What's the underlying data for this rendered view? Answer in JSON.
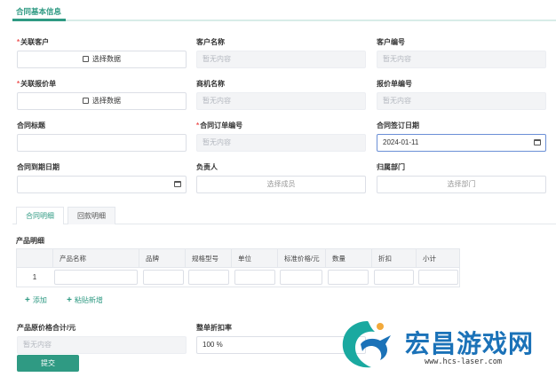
{
  "section_tab": "合同基本信息",
  "fields": {
    "customer": {
      "label": "关联客户",
      "required": true,
      "value": "选择数据"
    },
    "customer_name": {
      "label": "客户名称",
      "value": "暂无内容"
    },
    "customer_no": {
      "label": "客户编号",
      "value": "暂无内容"
    },
    "quote": {
      "label": "关联报价单",
      "required": true,
      "value": "选择数据"
    },
    "opportunity": {
      "label": "商机名称",
      "value": "暂无内容"
    },
    "quote_no": {
      "label": "报价单编号",
      "value": "暂无内容"
    },
    "title": {
      "label": "合同标题",
      "value": ""
    },
    "order_no": {
      "label": "合同订单编号",
      "required": true,
      "value": "暂无内容"
    },
    "sign_date": {
      "label": "合同签订日期",
      "value": "2024-01-11"
    },
    "expire_date": {
      "label": "合同到期日期",
      "value": ""
    },
    "owner": {
      "label": "负责人",
      "value": "选择成员"
    },
    "dept": {
      "label": "归属部门",
      "value": "选择部门"
    }
  },
  "detail_tabs": [
    "合同明细",
    "回款明细"
  ],
  "product": {
    "title": "产品明细",
    "columns": [
      "",
      "产品名称",
      "品牌",
      "规格型号",
      "单位",
      "标准价格/元",
      "数量",
      "折扣",
      "小计"
    ],
    "rows": [
      {
        "index": "1"
      }
    ]
  },
  "actions": {
    "add": "添加",
    "paste": "粘贴新增"
  },
  "bottom": {
    "original_total": {
      "label": "产品原价格合计/元",
      "value": "暂无内容"
    },
    "discount": {
      "label": "整单折扣率",
      "value": "100 %"
    }
  },
  "submit": "提交",
  "watermark": {
    "text": "宏昌游戏网",
    "url": "www.hcs-laser.com"
  },
  "colors": {
    "accent": "#2f9a83",
    "required": "#ee5555",
    "watermark": "#1b72b8"
  }
}
